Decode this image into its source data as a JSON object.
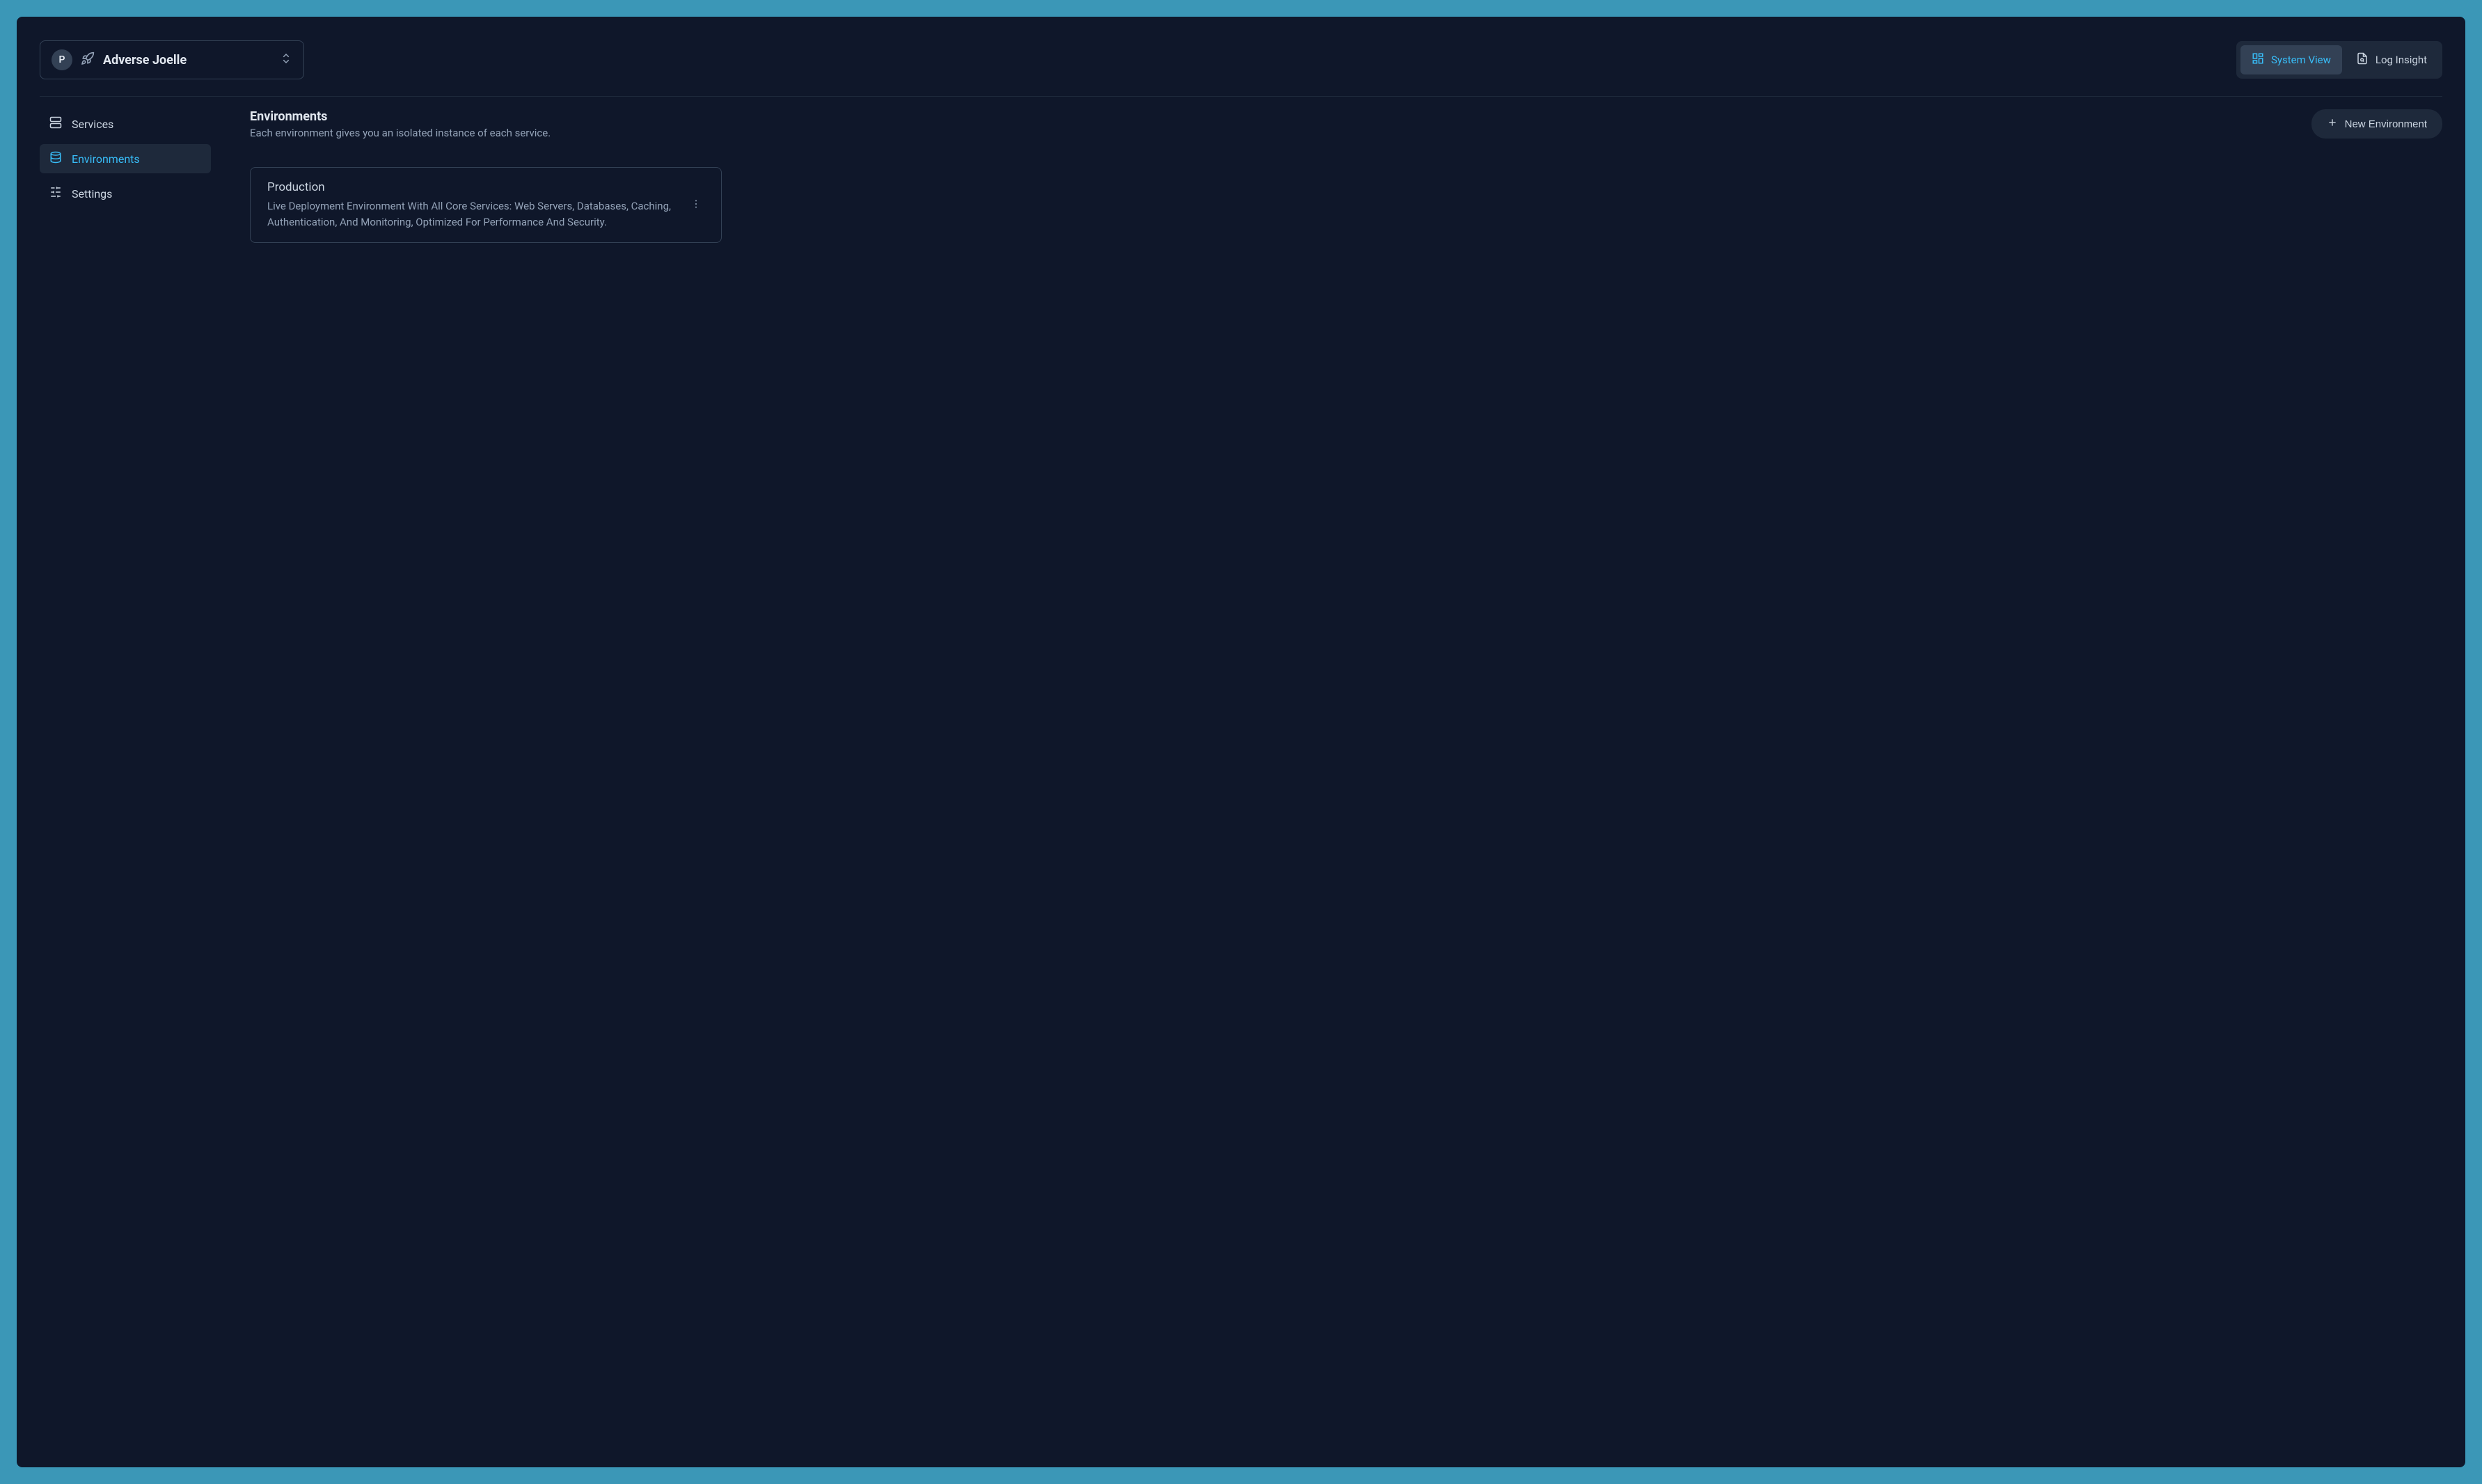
{
  "project": {
    "avatar_letter": "P",
    "name": "Adverse Joelle"
  },
  "view_tabs": {
    "system_view": "System View",
    "log_insight": "Log Insight"
  },
  "sidebar": {
    "services": "Services",
    "environments": "Environments",
    "settings": "Settings"
  },
  "page": {
    "title": "Environments",
    "subtitle": "Each environment gives you an isolated instance of each service.",
    "new_button": "New Environment"
  },
  "environments": [
    {
      "name": "Production",
      "description": "Live Deployment Environment With All Core Services: Web Servers, Databases, Caching, Authentication, And Monitoring, Optimized For Performance And Security."
    }
  ]
}
